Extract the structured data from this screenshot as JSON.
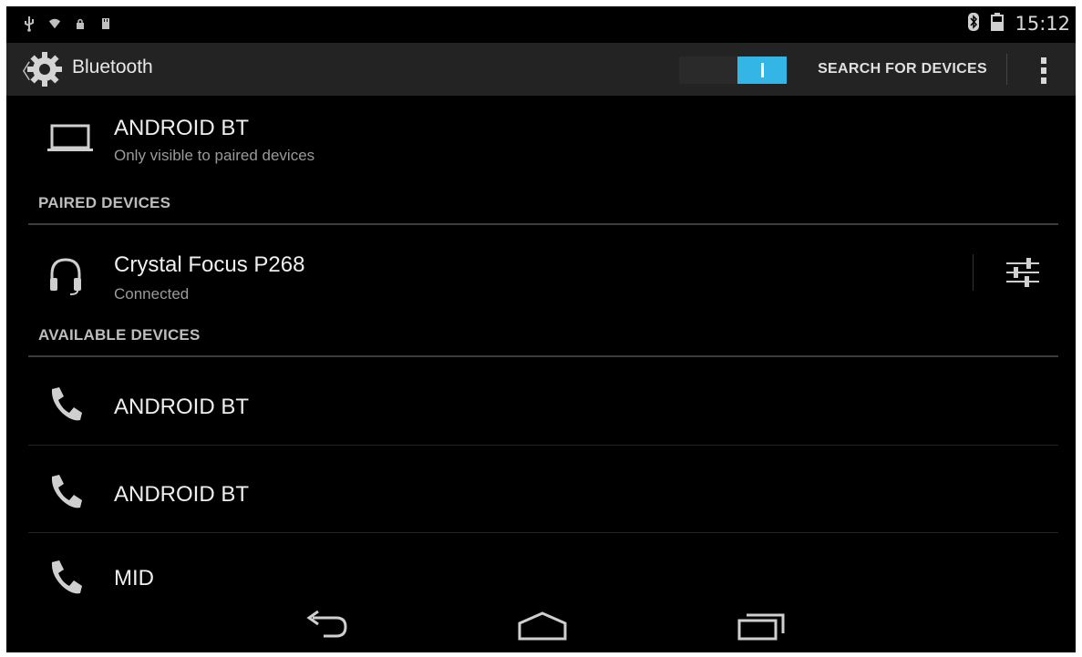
{
  "status_bar": {
    "left_icons": [
      "usb-icon",
      "wifi-icon",
      "lock-icon",
      "sd-card-icon"
    ],
    "right_icons": [
      "bluetooth-icon",
      "battery-icon"
    ],
    "time": "15:12"
  },
  "action_bar": {
    "up_glyph": "〈",
    "title": "Bluetooth",
    "toggle_on": true,
    "search_label": "SEARCH FOR DEVICES",
    "overflow_icon": "overflow-menu-icon"
  },
  "this_device": {
    "icon": "laptop-icon",
    "name": "ANDROID BT",
    "status": "Only visible to paired devices"
  },
  "paired": {
    "header": "PAIRED DEVICES",
    "items": [
      {
        "icon": "headset-icon",
        "name": "Crystal Focus P268",
        "status": "Connected",
        "settings_icon": "tune-settings-icon"
      }
    ]
  },
  "available": {
    "header": "AVAILABLE DEVICES",
    "items": [
      {
        "icon": "phone-icon",
        "name": "ANDROID BT"
      },
      {
        "icon": "phone-icon",
        "name": "ANDROID BT"
      },
      {
        "icon": "phone-icon",
        "name": "MID"
      }
    ]
  },
  "nav_bar": {
    "buttons": [
      "back-icon",
      "home-icon",
      "recents-icon"
    ]
  },
  "colors": {
    "accent": "#33b5e5",
    "action_bar_bg": "#232323",
    "background": "#000000"
  }
}
